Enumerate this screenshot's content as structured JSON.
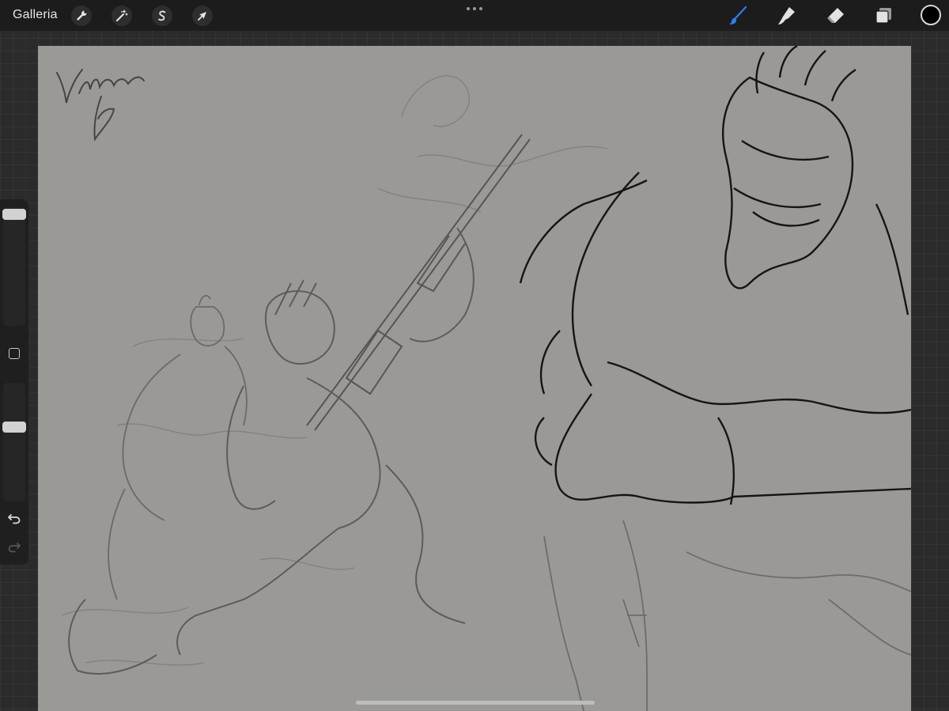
{
  "topbar": {
    "gallery_label": "Galleria",
    "left_tools": [
      {
        "name": "actions",
        "icon": "wrench-icon"
      },
      {
        "name": "adjustments",
        "icon": "magic-wand-icon"
      },
      {
        "name": "selection",
        "icon": "selection-s-icon"
      },
      {
        "name": "transform",
        "icon": "arrow-cursor-icon"
      }
    ],
    "right_tools": [
      {
        "name": "brush",
        "icon": "brush-icon",
        "active": true,
        "color": "#2f7cf6"
      },
      {
        "name": "smudge",
        "icon": "smudge-finger-icon",
        "active": false
      },
      {
        "name": "eraser",
        "icon": "eraser-icon",
        "active": false
      },
      {
        "name": "layers",
        "icon": "layers-icon",
        "active": false
      }
    ],
    "current_color": "#000000"
  },
  "canvas": {
    "background_color": "#9b9996",
    "artwork": "sketch"
  },
  "sidebar": {
    "brush_size_icon": "size-slider-icon",
    "opacity_icon": "opacity-slider-icon",
    "modify_icon": "square-modify-icon",
    "undo_icon": "undo-arrow-icon",
    "redo_icon": "redo-arrow-icon"
  }
}
